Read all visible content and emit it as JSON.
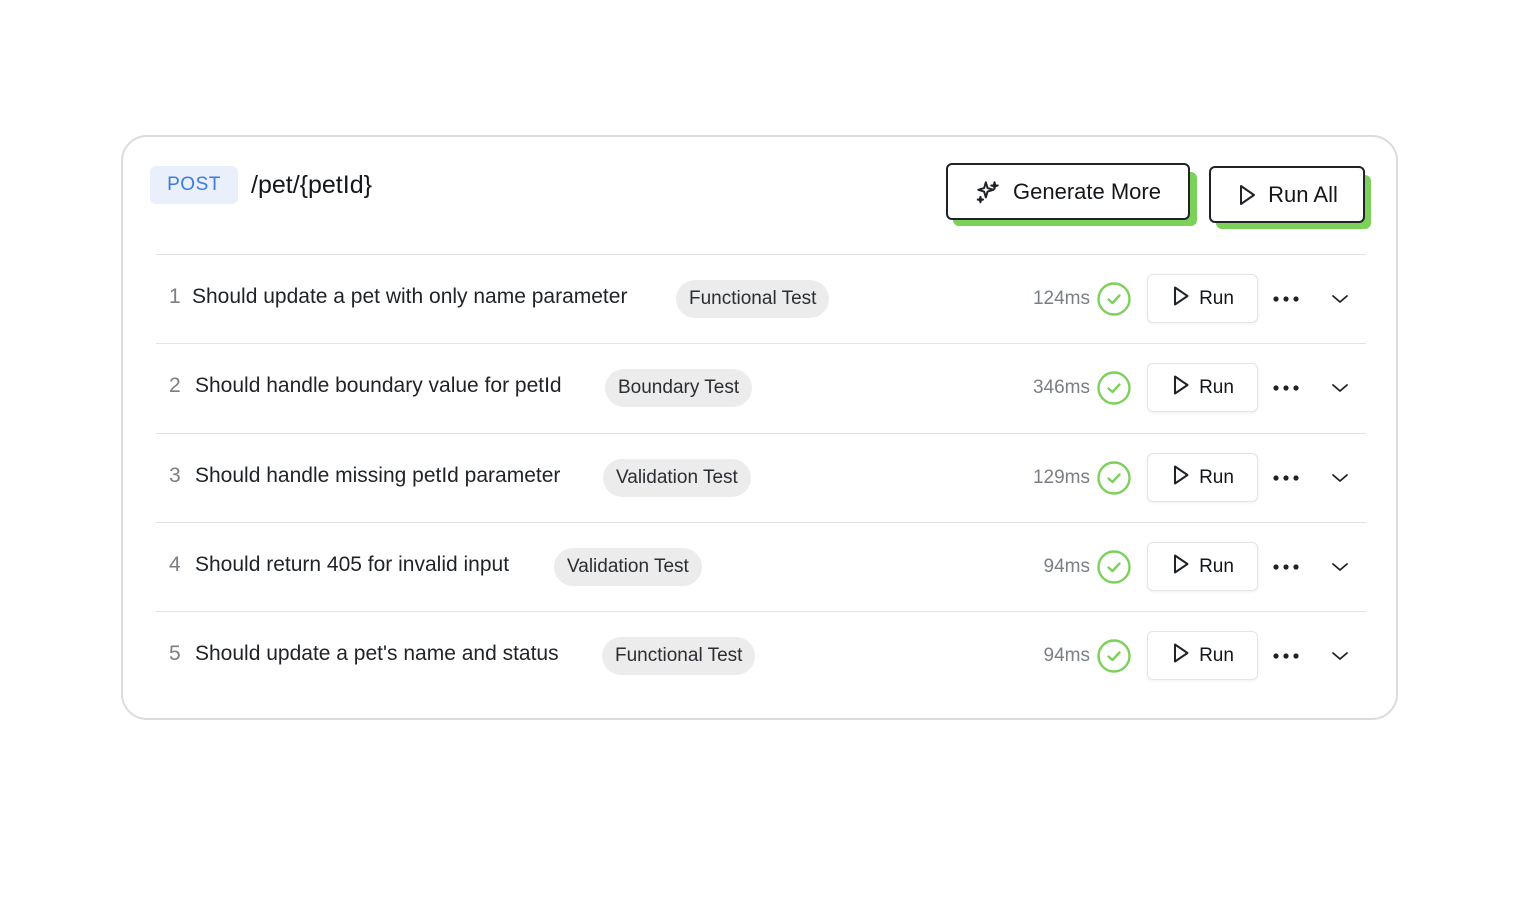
{
  "endpoint": {
    "method": "POST",
    "path": "/pet/{petId}"
  },
  "toolbar": {
    "generate_more_label": "Generate More",
    "run_all_label": "Run All"
  },
  "colors": {
    "accent_green": "#7cd15a",
    "method_blue": "#3b7be0",
    "success_green": "#7cd15a"
  },
  "tests": [
    {
      "index": "1",
      "title": "Should update a pet with only name parameter",
      "tag": "Functional Test",
      "duration": "124ms",
      "status": "passed",
      "run_label": "Run"
    },
    {
      "index": "2",
      "title": "Should handle boundary value for petId",
      "tag": "Boundary Test",
      "duration": "346ms",
      "status": "passed",
      "run_label": "Run"
    },
    {
      "index": "3",
      "title": "Should handle missing petId parameter",
      "tag": "Validation Test",
      "duration": "129ms",
      "status": "passed",
      "run_label": "Run"
    },
    {
      "index": "4",
      "title": "Should return 405 for invalid input",
      "tag": "Validation Test",
      "duration": "94ms",
      "status": "passed",
      "run_label": "Run"
    },
    {
      "index": "5",
      "title": "Should update a pet's name and status",
      "tag": "Functional Test",
      "duration": "94ms",
      "status": "passed",
      "run_label": "Run"
    }
  ]
}
